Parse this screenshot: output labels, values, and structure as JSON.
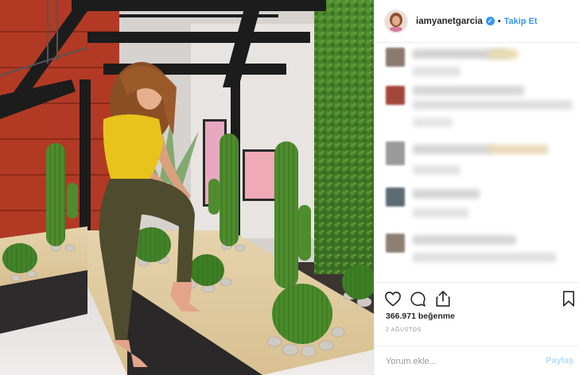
{
  "post": {
    "username": "iamyanetgarcia",
    "verified_glyph": "✓",
    "separator": "•",
    "follow_label": "Takip Et",
    "likes": "366.971 beğenme",
    "date": "2 AĞUSTOS"
  },
  "comment_box": {
    "placeholder": "Yorum ekle...",
    "submit_label": "Paylaş"
  },
  "icons": {
    "like": "heart-icon",
    "comment": "comment-bubble-icon",
    "share": "share-upload-icon",
    "save": "bookmark-icon",
    "verified": "verified-badge-icon"
  },
  "colors": {
    "accent_blue": "#3897f0",
    "text": "#262626",
    "muted": "#999999",
    "border": "#efefef"
  }
}
